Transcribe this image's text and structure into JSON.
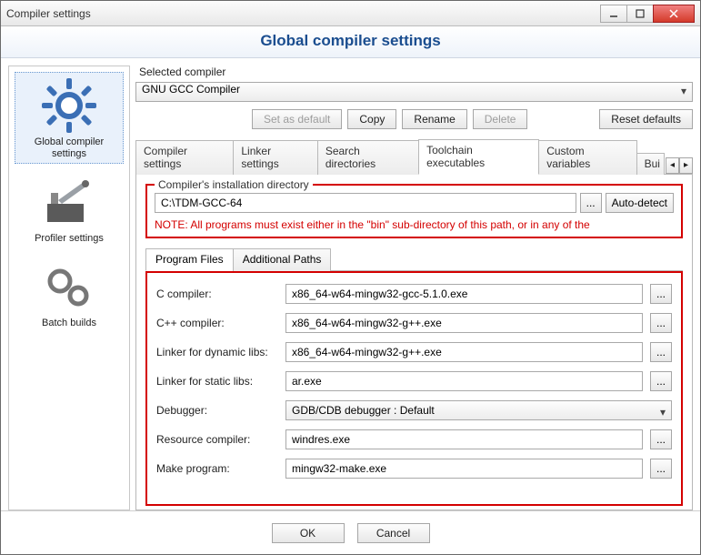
{
  "window": {
    "title": "Compiler settings"
  },
  "header": {
    "title": "Global compiler settings"
  },
  "sidebar": {
    "items": [
      {
        "label": "Global compiler settings"
      },
      {
        "label": "Profiler settings"
      },
      {
        "label": "Batch builds"
      }
    ]
  },
  "selected_compiler": {
    "label": "Selected compiler",
    "value": "GNU GCC Compiler"
  },
  "buttons": {
    "set_default": "Set as default",
    "copy": "Copy",
    "rename": "Rename",
    "delete": "Delete",
    "reset": "Reset defaults"
  },
  "tabs": [
    "Compiler settings",
    "Linker settings",
    "Search directories",
    "Toolchain executables",
    "Custom variables",
    "Bui"
  ],
  "install_dir": {
    "legend": "Compiler's installation directory",
    "path": "C:\\TDM-GCC-64",
    "browse": "...",
    "autodetect": "Auto-detect",
    "note": "NOTE: All programs must exist either in the \"bin\" sub-directory of this path, or in any of the"
  },
  "subtabs": [
    "Program Files",
    "Additional Paths"
  ],
  "programs": {
    "c_compiler": {
      "label": "C compiler:",
      "value": "x86_64-w64-mingw32-gcc-5.1.0.exe"
    },
    "cpp_compiler": {
      "label": "C++ compiler:",
      "value": "x86_64-w64-mingw32-g++.exe"
    },
    "linker_dyn": {
      "label": "Linker for dynamic libs:",
      "value": "x86_64-w64-mingw32-g++.exe"
    },
    "linker_static": {
      "label": "Linker for static libs:",
      "value": "ar.exe"
    },
    "debugger": {
      "label": "Debugger:",
      "value": "GDB/CDB debugger : Default"
    },
    "rc": {
      "label": "Resource compiler:",
      "value": "windres.exe"
    },
    "make": {
      "label": "Make program:",
      "value": "mingw32-make.exe"
    },
    "ellipsis": "..."
  },
  "footer": {
    "ok": "OK",
    "cancel": "Cancel"
  }
}
